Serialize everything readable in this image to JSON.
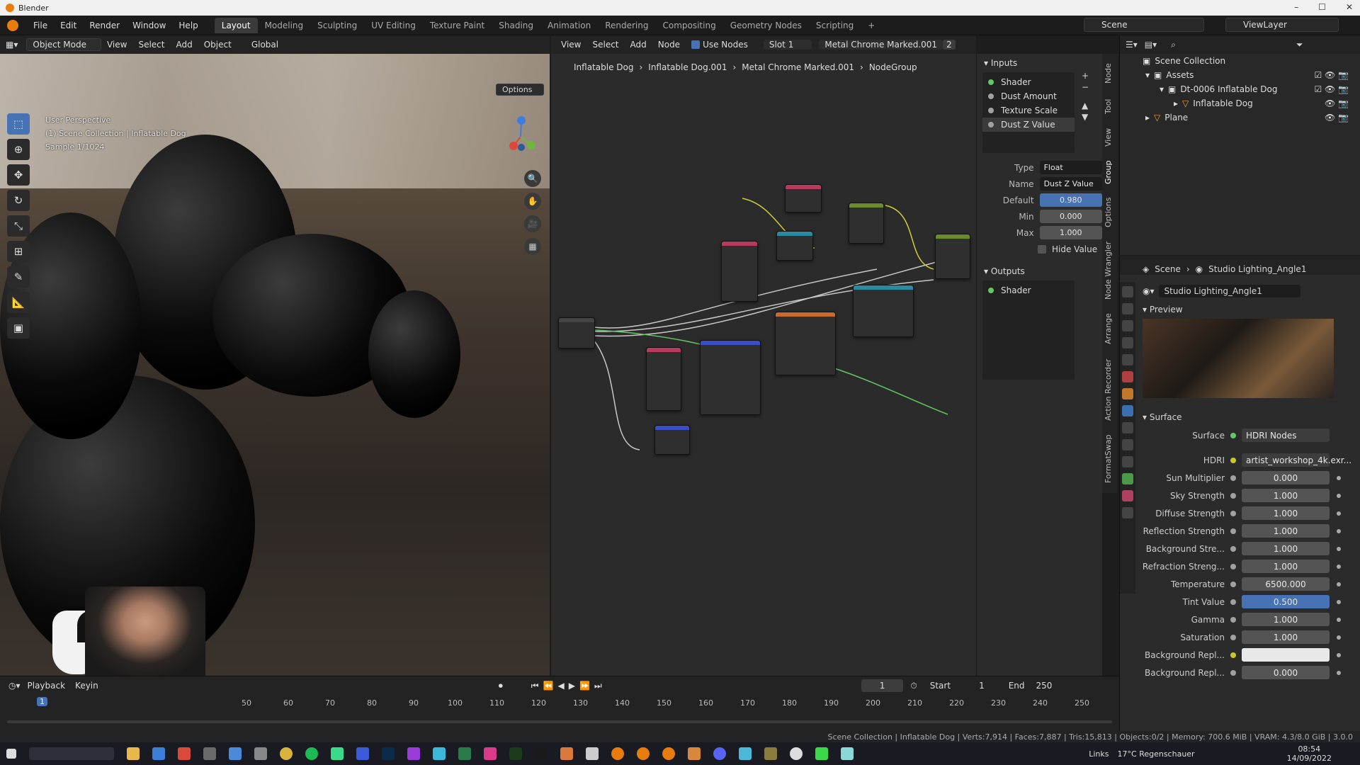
{
  "window": {
    "title": "Blender",
    "minimize": "–",
    "maximize": "☐",
    "close": "✕"
  },
  "menu": [
    "File",
    "Edit",
    "Render",
    "Window",
    "Help"
  ],
  "workspaces": [
    "Layout",
    "Modeling",
    "Sculpting",
    "UV Editing",
    "Texture Paint",
    "Shading",
    "Animation",
    "Rendering",
    "Compositing",
    "Geometry Nodes",
    "Scripting",
    "+"
  ],
  "scene": {
    "label": "Scene",
    "viewlayer": "ViewLayer"
  },
  "viewport": {
    "mode": "Object Mode",
    "menus": [
      "View",
      "Select",
      "Add",
      "Object"
    ],
    "transform": "Global",
    "options": "Options",
    "info_line1": "User Perspective",
    "info_line2": "(1) Scene Collection | Inflatable Dog",
    "info_line3": "Sample 1/1024"
  },
  "node_editor": {
    "menus": [
      "View",
      "Select",
      "Add",
      "Node"
    ],
    "use_nodes": "Use Nodes",
    "slot": "Slot 1",
    "material": "Metal Chrome Marked.001",
    "users": "2",
    "breadcrumb": [
      "Inflatable Dog",
      "Inflatable Dog.001",
      "Metal Chrome Marked.001",
      "NodeGroup"
    ]
  },
  "group_panel": {
    "inputs_title": "Inputs",
    "inputs": [
      "Shader",
      "Dust Amount",
      "Texture Scale",
      "Dust Z Value"
    ],
    "type_label": "Type",
    "type_value": "Float",
    "name_label": "Name",
    "name_value": "Dust Z Value",
    "default_label": "Default",
    "default_value": "0.980",
    "min_label": "Min",
    "min_value": "0.000",
    "max_label": "Max",
    "max_value": "1.000",
    "hide_value": "Hide Value",
    "outputs_title": "Outputs",
    "outputs": [
      "Shader"
    ]
  },
  "side_tabs": [
    "Node",
    "Tool",
    "View",
    "Group",
    "Options",
    "Node Wrangler",
    "Arrange",
    "Action Recorder",
    "FormatSwap"
  ],
  "outliner": {
    "root": "Scene Collection",
    "rows": [
      "Assets",
      "Dt-0006 Inflatable Dog",
      "Inflatable Dog",
      "Plane"
    ]
  },
  "properties": {
    "breadcrumb_scene": "Scene",
    "breadcrumb_world": "Studio Lighting_Angle1",
    "world_name": "Studio Lighting_Angle1",
    "preview": "Preview",
    "surface_section": "Surface",
    "surface_label": "Surface",
    "surface_value": "HDRI Nodes",
    "hdri_label": "HDRI",
    "hdri_value": "artist_workshop_4k.exr...",
    "params": [
      {
        "label": "Sun Multiplier",
        "value": "0.000"
      },
      {
        "label": "Sky Strength",
        "value": "1.000"
      },
      {
        "label": "Diffuse Strength",
        "value": "1.000"
      },
      {
        "label": "Reflection Strength",
        "value": "1.000"
      },
      {
        "label": "Background Stre...",
        "value": "1.000"
      },
      {
        "label": "Refraction Streng...",
        "value": "1.000"
      },
      {
        "label": "Temperature",
        "value": "6500.000"
      },
      {
        "label": "Tint Value",
        "value": "0.500"
      },
      {
        "label": "Gamma",
        "value": "1.000"
      },
      {
        "label": "Saturation",
        "value": "1.000"
      },
      {
        "label": "Background Repl...",
        "value": ""
      },
      {
        "label": "Background Repl...",
        "value": "0.000"
      }
    ]
  },
  "timeline": {
    "playback": "Playback",
    "keying": "Keyin",
    "current_frame": "1",
    "start_label": "Start",
    "start": "1",
    "end_label": "End",
    "end": "250",
    "ruler_current": "1",
    "ticks": [
      "50",
      "60",
      "70",
      "80",
      "90",
      "100",
      "110",
      "120",
      "130",
      "140",
      "150",
      "160",
      "170",
      "180",
      "190",
      "200",
      "210",
      "220",
      "230",
      "240",
      "250"
    ]
  },
  "status": "Scene Collection | Inflatable Dog | Verts:7,914 | Faces:7,887 | Tris:15,813 | Objects:0/2 | Memory: 700.6 MiB | VRAM: 4.3/8.0 GiB | 3.0.0",
  "taskbar": {
    "weather": "17°C  Regenschauer",
    "lang": "Links",
    "time": "08:54",
    "date": "14/09/2022"
  }
}
